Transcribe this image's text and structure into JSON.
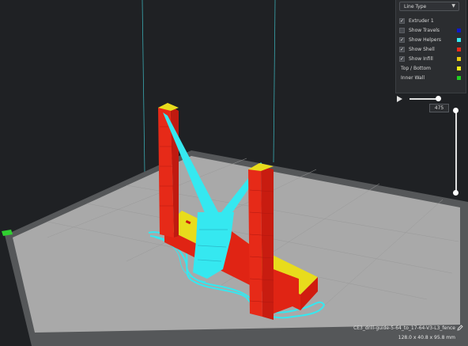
{
  "layer_view": {
    "dropdown": {
      "selected": "Line Type",
      "icon": "chevron-down-icon"
    },
    "items": [
      {
        "label": "Extruder 1",
        "checked": true,
        "swatch": null
      },
      {
        "label": "Show Travels",
        "checked": false,
        "swatch": "#0e18c8"
      },
      {
        "label": "Show Helpers",
        "checked": true,
        "swatch": "#35e8f0"
      },
      {
        "label": "Show Shell",
        "checked": true,
        "swatch": "#ee2a18"
      },
      {
        "label": "Show Infill",
        "checked": true,
        "swatch": "#e8cc10"
      }
    ],
    "legend": [
      {
        "label": "Top / Bottom",
        "swatch": "#f2ec1a"
      },
      {
        "label": "Inner Wall",
        "swatch": "#20d020"
      }
    ]
  },
  "layer_slider": {
    "current_layer": "475",
    "play_icon": "play-icon"
  },
  "file_info": {
    "name": "CE3_drill-guide-5-64_to_17-64-V3-L3_fence",
    "dimensions": "128.0 x 40.8 x 95.8 mm",
    "edit_icon": "pencil-icon"
  },
  "colors": {
    "background": "#1f2124",
    "build_plate": "#a8a8a8",
    "plate_border": "#5a5a5a",
    "shell": "#ee2a18",
    "helpers": "#35e8f0",
    "top_bottom": "#f2ec1a",
    "axis_line": "#38c8c8"
  }
}
